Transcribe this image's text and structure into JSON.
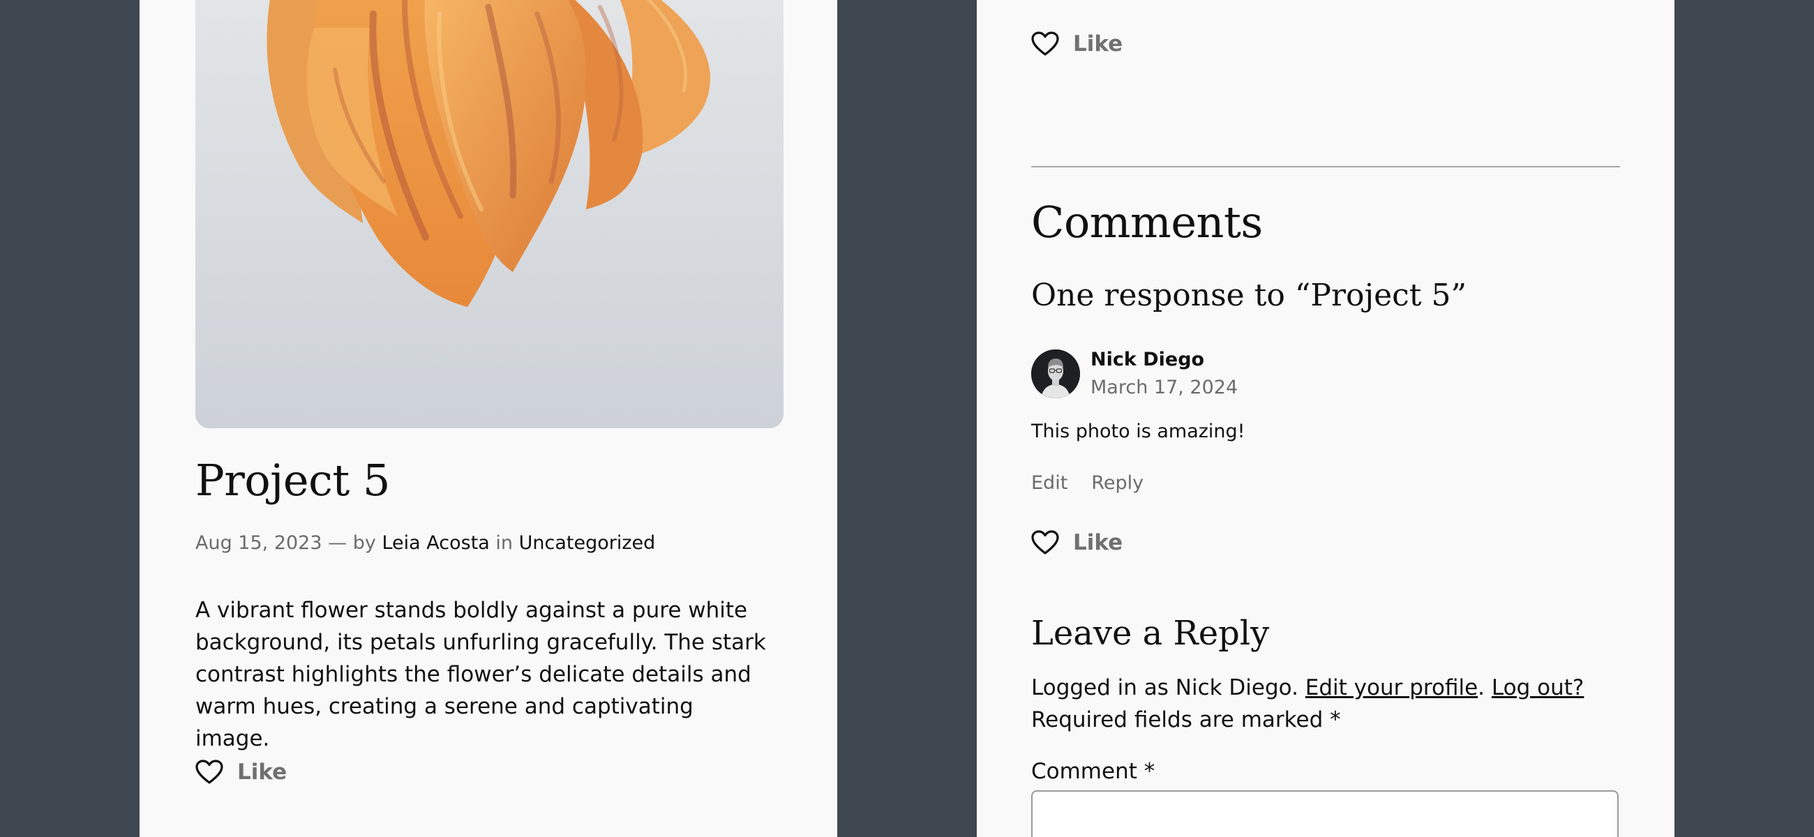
{
  "post": {
    "title": "Project 5",
    "date": "Aug 15, 2023",
    "dash": "—",
    "by_label": "by",
    "author": "Leia Acosta",
    "in_label": "in",
    "category": "Uncategorized",
    "excerpt": "A vibrant flower stands boldly against a pure white background, its petals unfurling gracefully. The stark contrast highlights the flower’s delicate details and warm hues, creating a serene and captivating image.",
    "like_label": "Like",
    "image_icon": "orange-tulip-photo"
  },
  "comments_section": {
    "top_like_label": "Like",
    "heading": "Comments",
    "response_heading": "One response to “Project 5”",
    "comment": {
      "author": "Nick Diego",
      "date": "March 17, 2024",
      "text": "This photo is amazing!",
      "edit_label": "Edit",
      "reply_label": "Reply",
      "like_label": "Like"
    }
  },
  "reply_form": {
    "heading": "Leave a Reply",
    "logged_in_prefix": "Logged in as Nick Diego.",
    "edit_profile_link": "Edit your profile",
    "period": ".",
    "logout_link": "Log out?",
    "required_note": "Required fields are marked *",
    "comment_label": "Comment *",
    "comment_value": ""
  },
  "colors": {
    "page_background": "#3f4850",
    "panel_background": "#f9f9f9",
    "muted_text": "#6b6b6b",
    "like_text": "#707070"
  }
}
